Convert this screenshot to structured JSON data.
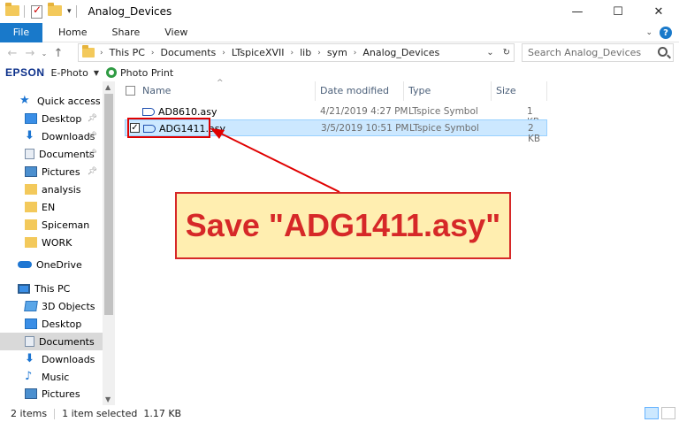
{
  "window": {
    "title": "Analog_Devices",
    "minimize": "—",
    "maximize": "☐",
    "close": "✕"
  },
  "ribbon": {
    "file": "File",
    "tabs": [
      "Home",
      "Share",
      "View"
    ]
  },
  "address": {
    "crumbs": [
      "This PC",
      "Documents",
      "LTspiceXVII",
      "lib",
      "sym",
      "Analog_Devices"
    ],
    "search_placeholder": "Search Analog_Devices"
  },
  "toolbar": {
    "brand": "EPSON",
    "ephoto": "E-Photo",
    "photo_print": "Photo Print"
  },
  "sidebar": {
    "items": [
      {
        "label": "Quick access"
      },
      {
        "label": "Desktop"
      },
      {
        "label": "Downloads"
      },
      {
        "label": "Documents"
      },
      {
        "label": "Pictures"
      },
      {
        "label": "analysis"
      },
      {
        "label": "EN"
      },
      {
        "label": "Spiceman"
      },
      {
        "label": "WORK"
      },
      {
        "label": "OneDrive"
      },
      {
        "label": "This PC"
      },
      {
        "label": "3D Objects"
      },
      {
        "label": "Desktop"
      },
      {
        "label": "Documents"
      },
      {
        "label": "Downloads"
      },
      {
        "label": "Music"
      },
      {
        "label": "Pictures"
      }
    ]
  },
  "columns": {
    "name": "Name",
    "date": "Date modified",
    "type": "Type",
    "size": "Size"
  },
  "files": [
    {
      "name": "AD8610.asy",
      "date": "4/21/2019 4:27 PM",
      "type": "LTspice Symbol",
      "size": "1 KB"
    },
    {
      "name": "ADG1411.asy",
      "date": "3/5/2019 10:51 PM",
      "type": "LTspice Symbol",
      "size": "2 KB"
    }
  ],
  "annotation": {
    "text": "Save \"ADG1411.asy\"",
    "color": "#d62828",
    "fill": "#ffeeb0"
  },
  "status": {
    "count": "2 items",
    "selection": "1 item selected  1.17 KB"
  },
  "colors": {
    "accent": "#1979ca",
    "selection": "#cce8ff"
  }
}
